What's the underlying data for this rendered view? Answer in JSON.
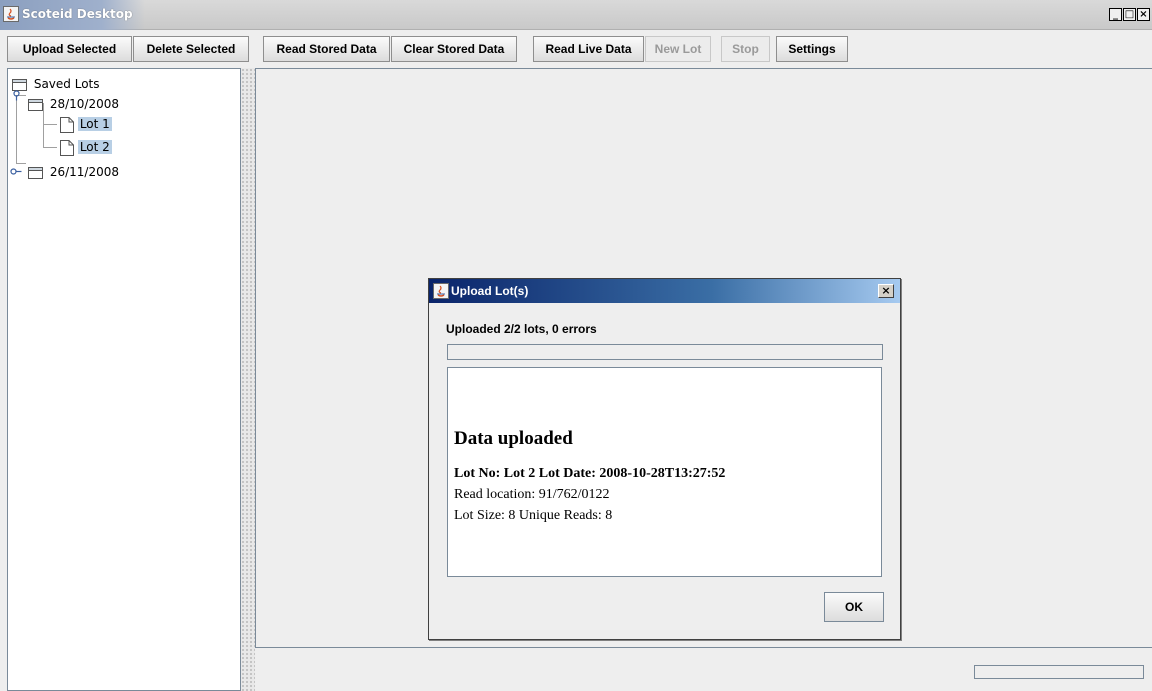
{
  "window": {
    "title": "Scoteid Desktop",
    "controls": [
      "_",
      "□",
      "×"
    ]
  },
  "toolbar": {
    "buttons": [
      {
        "label": "Upload Selected",
        "enabled": true
      },
      {
        "label": "Delete Selected",
        "enabled": true
      },
      {
        "label": "Read Stored Data",
        "enabled": true
      },
      {
        "label": "Clear Stored Data",
        "enabled": true
      },
      {
        "label": "Read Live Data",
        "enabled": true
      },
      {
        "label": "New Lot",
        "enabled": false
      },
      {
        "label": "Stop",
        "enabled": false
      },
      {
        "label": "Settings",
        "enabled": true
      }
    ]
  },
  "tree": {
    "root": "Saved Lots",
    "dates": [
      {
        "label": "28/10/2008",
        "expanded": true,
        "lots": [
          "Lot 1",
          "Lot 2"
        ]
      },
      {
        "label": "26/11/2008",
        "expanded": false,
        "lots": []
      }
    ]
  },
  "dialog": {
    "title": "Upload Lot(s)",
    "close": "×",
    "status": "Uploaded 2/2 lots, 0 errors",
    "progress": 0,
    "content": {
      "heading": "Data uploaded",
      "line1": "Lot No: Lot 2 Lot Date: 2008-10-28T13:27:52",
      "line2": "Read location: 91/762/0122",
      "line3": "Lot Size: 8 Unique Reads: 8"
    },
    "ok_label": "OK"
  },
  "statusbar": {
    "progress": 0
  }
}
